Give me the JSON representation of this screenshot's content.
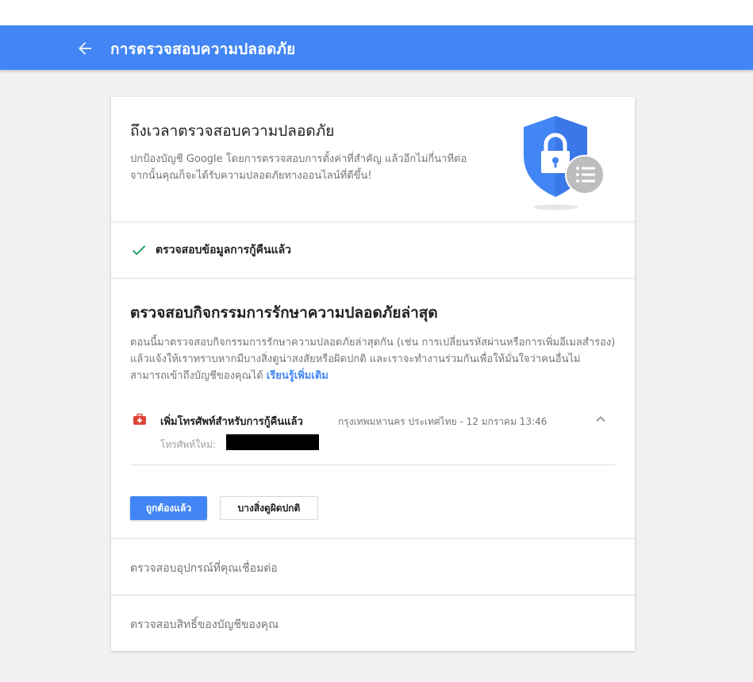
{
  "header": {
    "title": "การตรวจสอบความปลอดภัย"
  },
  "intro": {
    "title": "ถึงเวลาตรวจสอบความปลอดภัย",
    "description": "ปกป้องบัญชี Google โดยการตรวจสอบการตั้งค่าที่สำคัญ แล้วอีกไม่กี่นาทีต่อจากนั้นคุณก็จะได้รับความปลอดภัยทางออนไลน์ที่ดีขึ้น!"
  },
  "recovery": {
    "label": "ตรวจสอบข้อมูลการกู้คืนแล้ว"
  },
  "activity": {
    "title": "ตรวจสอบกิจกรรมการรักษาความปลอดภัยล่าสุด",
    "description": "ตอนนี้มาตรวจสอบกิจกรรมการรักษาความปลอดภัยล่าสุดกัน (เช่น การเปลี่ยนรหัสผ่านหรือการเพิ่มอีเมลสำรอง) แล้วแจ้งให้เราทราบหากมีบางสิ่งดูน่าสงสัยหรือผิดปกติ และเราจะทำงานร่วมกันเพื่อให้มั่นใจว่าคนอื่นไม่สามารถเข้าถึงบัญชีของคุณได้ ",
    "learn_more": "เรียนรู้เพิ่มเติม",
    "event": {
      "title": "เพิ่มโทรศัพท์สำหรับการกู้คืนแล้ว",
      "meta": "กรุงเทพมหานคร ประเทศไทย - 12 มกราคม 13:46",
      "phone_label": "โทรศัพท์ใหม่:"
    },
    "confirm_button": "ถูกต้องแล้ว",
    "suspicious_button": "บางสิ่งดูผิดปกติ"
  },
  "devices": {
    "label": "ตรวจสอบอุปกรณ์ที่คุณเชื่อมต่อ"
  },
  "permissions": {
    "label": "ตรวจสอบสิทธิ์ของบัญชีของคุณ"
  },
  "colors": {
    "appbar": "#4285f4",
    "shield": "#4285f4",
    "check": "#0f9d58",
    "event_icon": "#db4437"
  }
}
